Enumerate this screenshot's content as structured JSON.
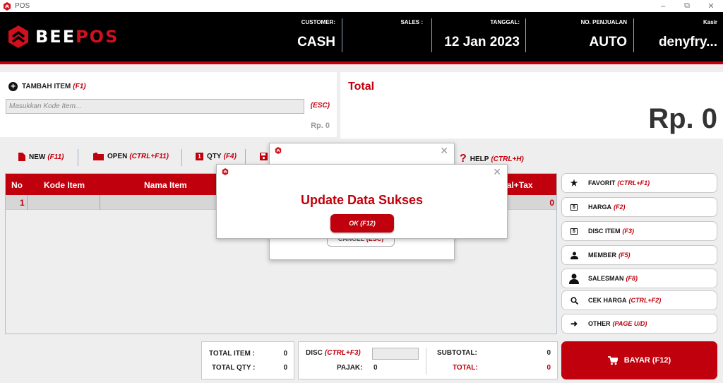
{
  "window": {
    "title": "POS",
    "controls": [
      "minimize",
      "maximize",
      "close"
    ]
  },
  "brand": {
    "logo_white": "BEE",
    "logo_red": "POS",
    "accent": "#c0000c"
  },
  "header": {
    "customer": {
      "label": "CUSTOMER:",
      "value": "CASH"
    },
    "sales": {
      "label": "SALES :",
      "value": ""
    },
    "tanggal": {
      "label": "TANGGAL:",
      "value": "12 Jan 2023"
    },
    "no_penjualan": {
      "label": "NO. PENJUALAN",
      "value": "AUTO"
    },
    "kasir": {
      "label": "Kasir",
      "value": "denyfry..."
    }
  },
  "add_item": {
    "title": "TAMBAH ITEM",
    "shortcut": "(F1)",
    "placeholder": "Masukkan Kode Item...",
    "value": "",
    "esc_label": "(ESC)",
    "price": "Rp. 0"
  },
  "total_panel": {
    "label": "Total",
    "value": "Rp. 0"
  },
  "toolbar": [
    {
      "label": "NEW",
      "shortcut": "(F11)",
      "icon": "file-icon"
    },
    {
      "label": "OPEN",
      "shortcut": "(CTRL+F11)",
      "icon": "folder-icon"
    },
    {
      "label": "QTY",
      "shortcut": "(F4)",
      "icon": "qty-icon"
    },
    {
      "label": "",
      "shortcut": "",
      "icon": "save-icon"
    },
    {
      "label": "HELP",
      "shortcut": "(CTRL+H)",
      "icon": "help-icon"
    }
  ],
  "table": {
    "columns": [
      "No",
      "Kode Item",
      "Nama Item",
      "Total+Tax"
    ],
    "rows": [
      {
        "no": "1",
        "kode": "",
        "nama": "",
        "total_tax": "0"
      }
    ]
  },
  "side_buttons": [
    {
      "label": "FAVORIT",
      "shortcut": "(CTRL+F1)",
      "icon": "star-icon"
    },
    {
      "label": "HARGA",
      "shortcut": "(F2)",
      "icon": "price-tag-icon"
    },
    {
      "label": "DISC ITEM",
      "shortcut": "(F3)",
      "icon": "discount-icon"
    },
    {
      "label": "MEMBER",
      "shortcut": "(F5)",
      "icon": "user-icon"
    },
    {
      "label": "SALESMAN",
      "shortcut": "(F8)",
      "icon": "salesman-icon"
    },
    {
      "label": "CEK HARGA",
      "shortcut": "(CTRL+F2)",
      "icon": "search-icon"
    },
    {
      "label": "OTHER",
      "shortcut": "(PAGE U/D)",
      "icon": "arrow-right-icon"
    }
  ],
  "summary": {
    "total_item_label": "TOTAL ITEM :",
    "total_item": "0",
    "total_qty_label": "TOTAL QTY :",
    "total_qty": "0",
    "disc_label": "DISC",
    "disc_shortcut": "(CTRL+F3)",
    "disc_value": "",
    "pajak_label": "PAJAK:",
    "pajak": "0",
    "subtotal_label": "SUBTOTAL:",
    "subtotal": "0",
    "total_label": "TOTAL:",
    "total": "0"
  },
  "pay_button": {
    "label": "BAYAR (F12)"
  },
  "background_dialog": {
    "cancel_label": "CANCEL",
    "cancel_shortcut": "(ESC)"
  },
  "dialog": {
    "message": "Update Data Sukses",
    "ok_label": "OK (F12)"
  }
}
